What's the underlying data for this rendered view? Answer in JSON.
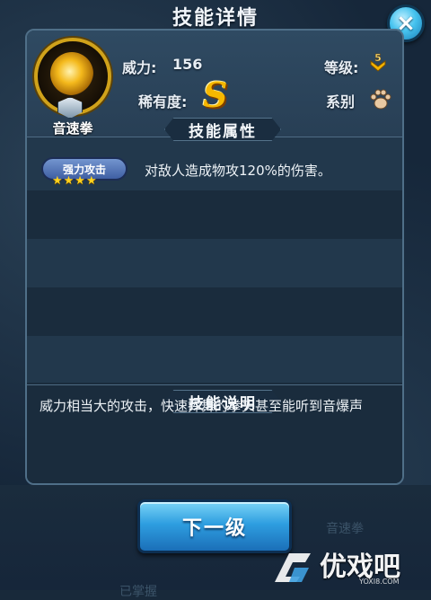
{
  "window": {
    "title": "技能详情"
  },
  "close_button": {
    "icon": "close-icon",
    "label": "×"
  },
  "skill": {
    "name": "音速拳",
    "power_label": "威力:",
    "power_value": "156",
    "level_label": "等级:",
    "level_value": "5",
    "rarity_label": "稀有度:",
    "rarity_value": "S",
    "type_label": "系别",
    "type_icon": "paw-icon"
  },
  "attributes_section": {
    "title": "技能属性",
    "items": [
      {
        "badge": "强力攻击",
        "stars": 4,
        "stars_text": "★★★★",
        "description": "对敌人造成物攻120%的伤害。"
      }
    ]
  },
  "description_section": {
    "title": "技能说明",
    "text": "威力相当大的攻击，快速挥舞的拳头甚至能听到音爆声"
  },
  "footer": {
    "next_button_label": "下一级",
    "bg_ghost_text_left": "已掌握",
    "bg_ghost_text_right": "音速拳"
  },
  "watermark": {
    "text": "优戏吧",
    "sub": "YOXI8.COM"
  },
  "colors": {
    "panel_bg": "#1d3144",
    "accent_gold": "#d0a21a",
    "button_blue": "#2e9ee0",
    "badge_blue": "#4f6fb5",
    "star_yellow": "#ffd21e"
  }
}
